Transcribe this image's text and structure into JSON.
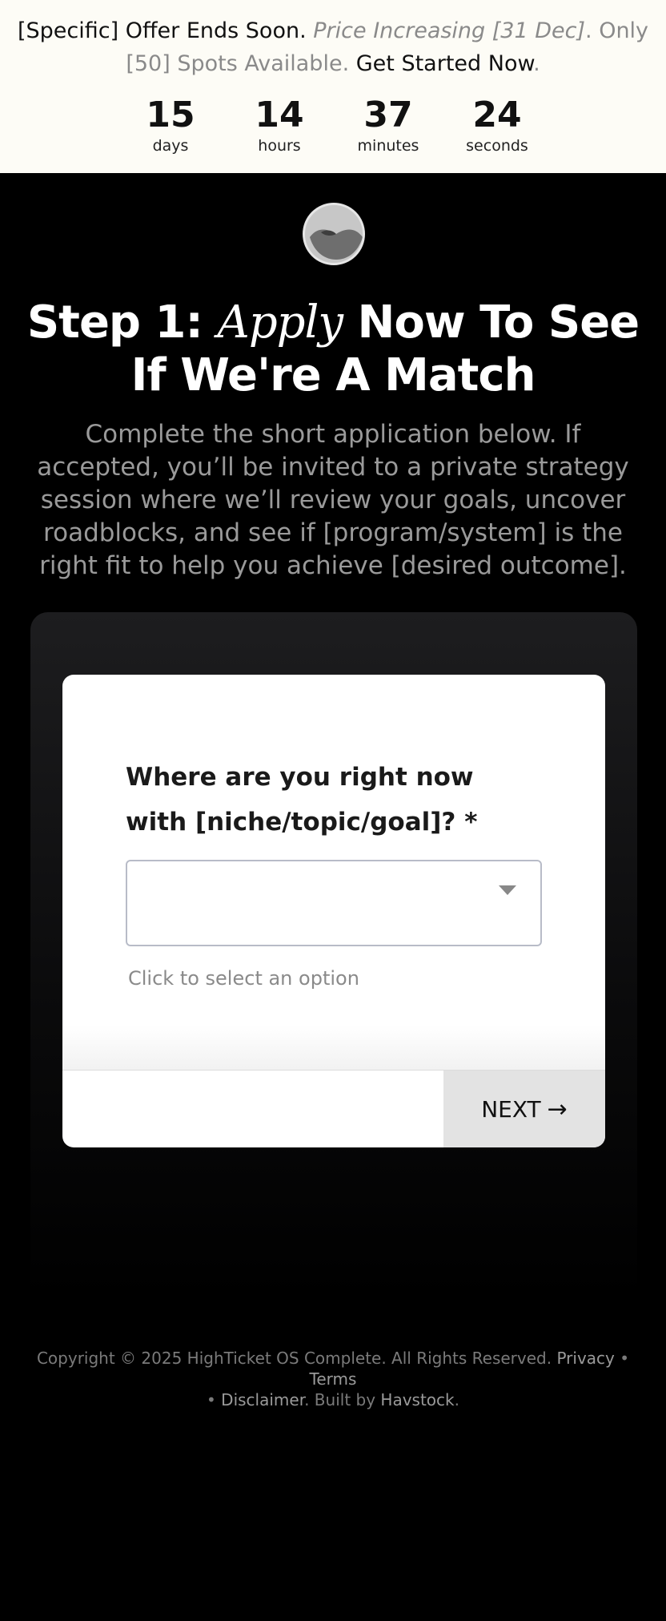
{
  "banner": {
    "part1": "[Specific] Offer Ends Soon.",
    "part2": "Price Increasing [31 Dec]",
    "part3": ". Only [50] Spots Available.",
    "cta": "Get Started Now",
    "cta_end": "."
  },
  "countdown": [
    {
      "value": "15",
      "label": "days"
    },
    {
      "value": "14",
      "label": "hours"
    },
    {
      "value": "37",
      "label": "minutes"
    },
    {
      "value": "24",
      "label": "seconds"
    }
  ],
  "headline": {
    "prefix": "Step 1: ",
    "script": "Apply",
    "suffix": " Now To See If We're A Match"
  },
  "subtext": "Complete the short application below. If accepted, you’ll be invited to a private strategy session where we’ll review your goals, uncover roadblocks, and see if [program/system] is the right fit to help you achieve [desired outcome].",
  "form": {
    "question": "Where are you right now with [niche/topic/goal]? *",
    "select_value": "",
    "hint": "Click to select an option",
    "next_label": "NEXT",
    "next_arrow": "→"
  },
  "footer": {
    "copyright": "Copyright © 2025 HighTicket OS Complete. All Rights Reserved.",
    "privacy": "Privacy",
    "sep1": " • ",
    "terms": "Terms",
    "sep2": " • ",
    "disclaimer": "Disclaimer",
    "built_by_prefix": ". Built by ",
    "builder": "Havstock",
    "built_by_suffix": "."
  }
}
